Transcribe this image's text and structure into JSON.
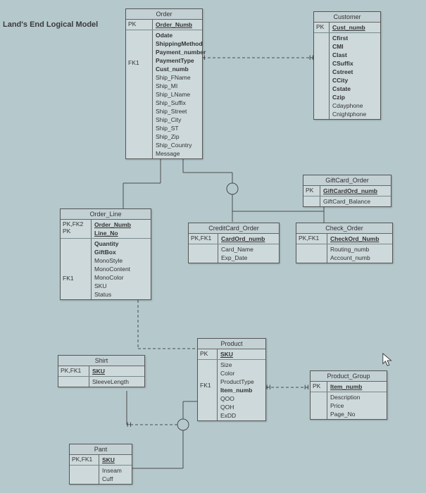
{
  "page_title": "Land's End Logical Model",
  "entities": {
    "order": {
      "title": "Order",
      "rows": [
        {
          "key": "PK",
          "attrs": [
            "Order_Numb"
          ],
          "underline": true,
          "bold": true
        },
        {
          "key": "FK1",
          "attrs": [
            "Odate",
            "ShippingMethod",
            "Payment_number",
            "PaymentType",
            "Cust_numb",
            "Ship_FName",
            "Ship_MI",
            "Ship_LName",
            "Ship_Suffix",
            "Ship_Street",
            "Ship_City",
            "Ship_ST",
            "Ship_Zip",
            "Ship_Country",
            "Message"
          ],
          "boldIdx": [
            0,
            1,
            2,
            3,
            4
          ]
        }
      ]
    },
    "customer": {
      "title": "Customer",
      "rows": [
        {
          "key": "PK",
          "attrs": [
            "Cust_numb"
          ],
          "underline": true,
          "bold": true
        },
        {
          "key": "",
          "attrs": [
            "Cfirst",
            "CMI",
            "Clast",
            "CSuffix",
            "Cstreet",
            "CCity",
            "Cstate",
            "Czip",
            "Cdayphone",
            "Cnightphone"
          ],
          "boldIdx": [
            0,
            1,
            2,
            3,
            4,
            5,
            6,
            7
          ]
        }
      ]
    },
    "giftcard_order": {
      "title": "GiftCard_Order",
      "rows": [
        {
          "key": "PK",
          "attrs": [
            "GiftCardOrd_numb"
          ],
          "underline": true,
          "bold": true
        },
        {
          "key": "",
          "attrs": [
            "GiftCard_Balance"
          ]
        }
      ]
    },
    "order_line": {
      "title": "Order_Line",
      "rows": [
        {
          "key": "PK,FK2\nPK",
          "attrs": [
            "Order_Numb",
            "Line_No"
          ],
          "underline": true,
          "bold": true
        },
        {
          "key": "FK1",
          "attrs": [
            "Quantity",
            "GiftBox",
            "MonoStyle",
            "MonoContent",
            "MonoColor",
            "SKU",
            "Status"
          ],
          "boldIdx": [
            0,
            1
          ]
        }
      ]
    },
    "creditcard_order": {
      "title": "CreditCard_Order",
      "rows": [
        {
          "key": "PK,FK1",
          "attrs": [
            "CardOrd_numb"
          ],
          "underline": true,
          "bold": true
        },
        {
          "key": "",
          "attrs": [
            "Card_Name",
            "Exp_Date"
          ]
        }
      ]
    },
    "check_order": {
      "title": "Check_Order",
      "rows": [
        {
          "key": "PK,FK1",
          "attrs": [
            "CheckOrd_Numb"
          ],
          "underline": true,
          "bold": true
        },
        {
          "key": "",
          "attrs": [
            "Routing_numb",
            "Account_numb"
          ]
        }
      ]
    },
    "shirt": {
      "title": "Shirt",
      "rows": [
        {
          "key": "PK,FK1",
          "attrs": [
            "SKU"
          ],
          "underline": true,
          "bold": true
        },
        {
          "key": "",
          "attrs": [
            "SleeveLength"
          ]
        }
      ]
    },
    "product": {
      "title": "Product",
      "rows": [
        {
          "key": "PK",
          "attrs": [
            "SKU"
          ],
          "underline": true,
          "bold": true
        },
        {
          "key": "FK1",
          "attrs": [
            "Size",
            "Color",
            "ProductType",
            "Item_numb",
            "QOO",
            "QOH",
            "ExDD"
          ],
          "boldIdx": [
            3
          ]
        }
      ]
    },
    "product_group": {
      "title": "Product_Group",
      "rows": [
        {
          "key": "PK",
          "attrs": [
            "Item_numb"
          ],
          "underline": true,
          "bold": true
        },
        {
          "key": "",
          "attrs": [
            "Description",
            "Price",
            "Page_No"
          ]
        }
      ]
    },
    "pant": {
      "title": "Pant",
      "rows": [
        {
          "key": "PK,FK1",
          "attrs": [
            "SKU"
          ],
          "underline": true,
          "bold": true
        },
        {
          "key": "",
          "attrs": [
            "Inseam",
            "Cuff"
          ]
        }
      ]
    }
  }
}
